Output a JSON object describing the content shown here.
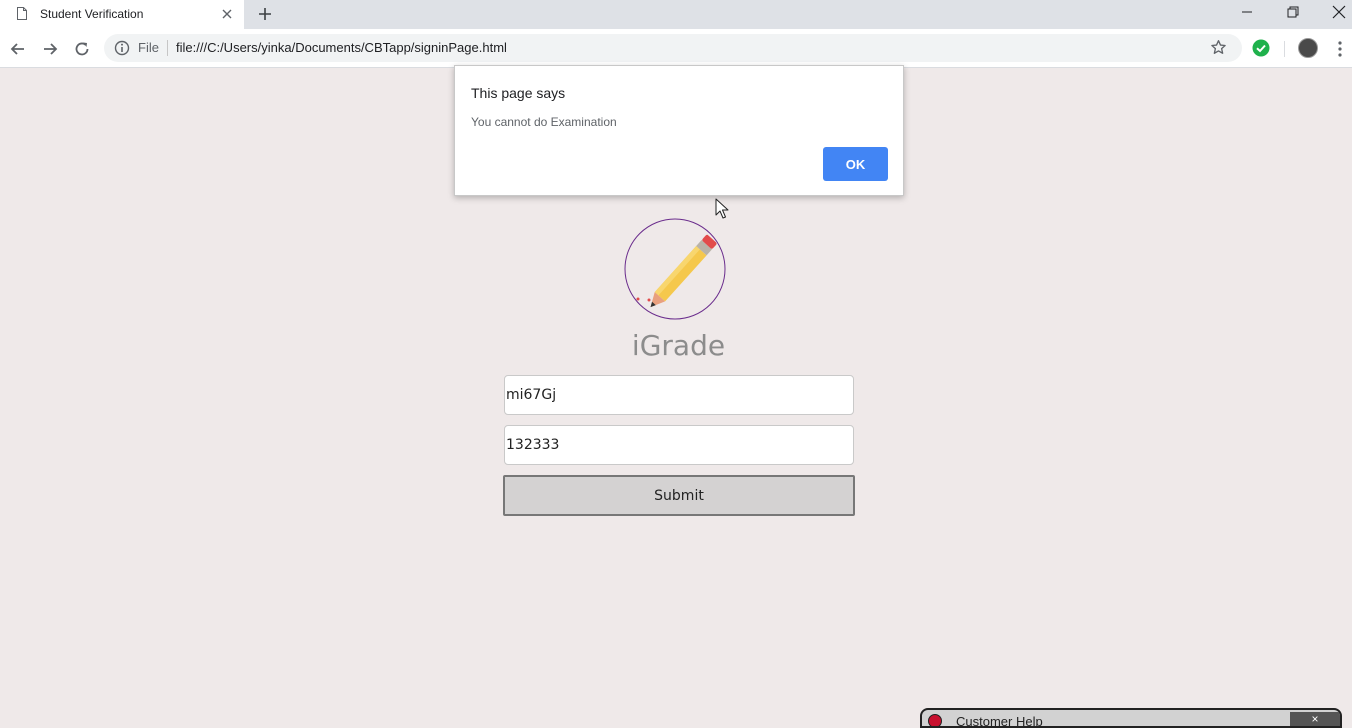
{
  "browser": {
    "tab_title": "Student Verification",
    "new_tab_label": "+",
    "file_chip": "File",
    "url": "file:///C:/Users/yinka/Documents/CBTapp/signinPage.html"
  },
  "page": {
    "brand": "iGrade",
    "username_value": "mi67Gj",
    "password_value": "132333",
    "submit_label": "Submit"
  },
  "dialog": {
    "title": "This page says",
    "message": "You cannot do Examination",
    "ok_label": "OK"
  },
  "popup": {
    "title": "Customer Help",
    "close_label": "×"
  },
  "colors": {
    "page_bg": "#efe9e9",
    "ok_button": "#4285f4",
    "logo_ring": "#6a2c8c",
    "pencil_body": "#f5c84c",
    "pencil_eraser": "#e24b4b"
  }
}
